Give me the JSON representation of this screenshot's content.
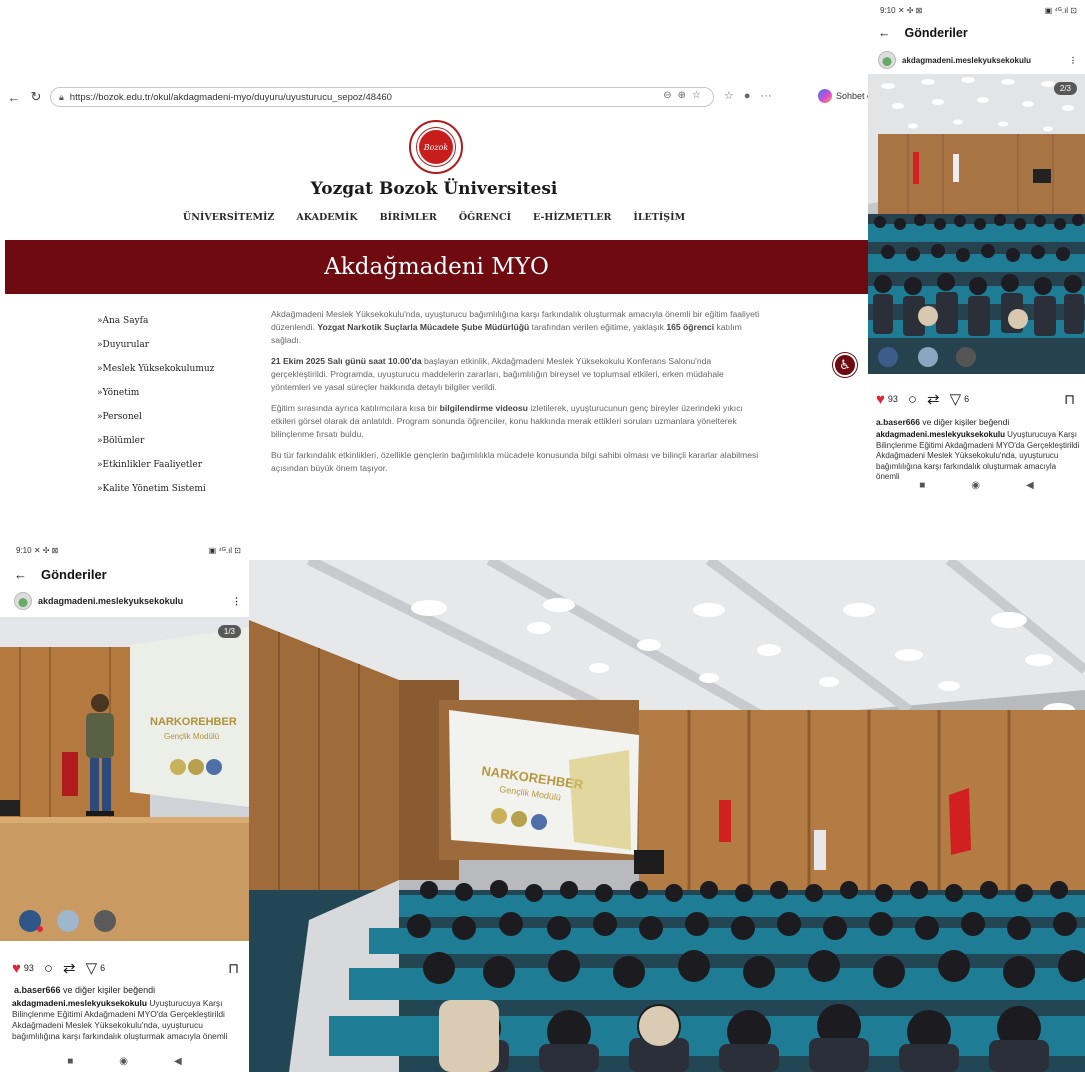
{
  "browser": {
    "url": "https://bozok.edu.tr/okul/akdagmadeni-myo/duyuru/uyusturucu_sepoz/48460",
    "copilot_label": "Sohbet et",
    "icons": [
      "back-icon",
      "refresh-icon",
      "lock-icon",
      "zoom-icon",
      "share-icon",
      "favorite-icon",
      "favorites-bar-icon",
      "profile-icon",
      "more-icon",
      "copilot-icon"
    ]
  },
  "site": {
    "university": "Yozgat Bozok Üniversitesi",
    "main_nav": [
      "ÜNİVERSİTEMİZ",
      "AKADEMİK",
      "BİRİMLER",
      "ÖĞRENCİ",
      "E-HİZMETLER",
      "İLETİŞİM"
    ],
    "banner_title": "Akdağmadeni MYO",
    "side_nav": [
      "»Ana Sayfa",
      "»Duyurular",
      "»Meslek Yüksekokulumuz",
      "»Yönetim",
      "»Personel",
      "»Bölümler",
      "»Etkinlikler Faaliyetler",
      "»Kalite Yönetim Sistemi"
    ],
    "article": {
      "p1": {
        "t1": "Akdağmadeni Meslek Yüksekokulu'nda, uyuşturucu bağımlılığına karşı farkındalık oluşturmak amacıyla önemli bir eğitim faaliyeti düzenlendi. ",
        "b1": "Yozgat Narkotik Suçlarla Mücadele Şube Müdürlüğü",
        "t2": " tarafından verilen eğitime, yaklaşık ",
        "b2": "165 öğrenci",
        "t3": " katılım sağladı."
      },
      "p2": {
        "b1": "21 Ekim 2025 Salı günü saat 10.00'da",
        "t1": " başlayan etkinlik, Akdağmadeni Meslek Yüksekokulu Konferans Salonu'nda gerçekleştirildi. Programda, uyuşturucu maddelerin zararları, bağımlılığın bireysel ve toplumsal etkileri, erken müdahale yöntemleri ve yasal süreçler hakkında detaylı bilgiler verildi."
      },
      "p3": {
        "t1": "Eğitim sırasında ayrıca katılımcılara kısa bir ",
        "b1": "bilgilendirme videosu",
        "t2": " izletilerek, uyuşturucunun genç bireyler üzerindeki yıkıcı etkileri görsel olarak da anlatıldı. Program sonunda öğrenciler, konu hakkında merak ettikleri soruları uzmanlara yönelterek bilinçlenme fırsatı buldu."
      },
      "p4": "Bu tür farkındalık etkinlikleri, özellikle gençlerin bağımlılıkla mücadele konusunda bilgi sahibi olması ve bilinçli kararlar alabilmesi açısından büyük önem taşıyor."
    }
  },
  "phone_right": {
    "time": "9:10",
    "status_icons": "✕ ✣ ⊠",
    "battery": "▣ ⁴ᴳ.ıl ⊡",
    "header": "Gönderiler",
    "account": "akdagmadeni.meslekyuksekokulu",
    "counter": "2/3",
    "like_count": "93",
    "share_count": "6",
    "liked_by_user": "a.baser666",
    "liked_by_rest": " ve diğer kişiler beğendi",
    "caption_user": "akdagmadeni.meslekyuksekokulu",
    "caption_text": " Uyuşturucuya Karşı Bilinçlenme Eğitimi Akdağmadeni MYO'da Gerçekleştirildi Akdağmadeni Meslek Yüksekokulu'nda, uyuşturucu bağımlılığına karşı farkındalık oluşturmak amacıyla önemli"
  },
  "phone_left": {
    "time": "9:10",
    "status_icons": "✕ ✣ ⊠",
    "battery": "▣ ⁴ᴳ.ıl ⊡",
    "header": "Gönderiler",
    "account": "akdagmadeni.meslekyuksekokulu",
    "counter": "1/3",
    "slide_title": "NARKOREHBER",
    "slide_subtitle": "Gençlik Modülü",
    "like_count": "93",
    "share_count": "6",
    "liked_by_user": "a.baser666",
    "liked_by_rest": " ve diğer kişiler beğendi",
    "caption_user": "akdagmadeni.meslekyuksekokulu",
    "caption_text": " Uyuşturucuya Karşı Bilinçlenme Eğitimi Akdağmadeni MYO'da Gerçekleştirildi Akdağmadeni Meslek Yüksekokulu'nda, uyuşturucu bağımlılığına karşı farkındalık oluşturmak amacıyla önemli"
  },
  "hall_photo": {
    "slide_title": "NARKOREHBER",
    "slide_subtitle": "Gençlik Modülü"
  },
  "colors": {
    "banner": "#6e0a10",
    "seal_red": "#c81d1d",
    "like_red": "#e0243a",
    "wood": "#b07a45",
    "seat_teal": "#1f7c95"
  }
}
